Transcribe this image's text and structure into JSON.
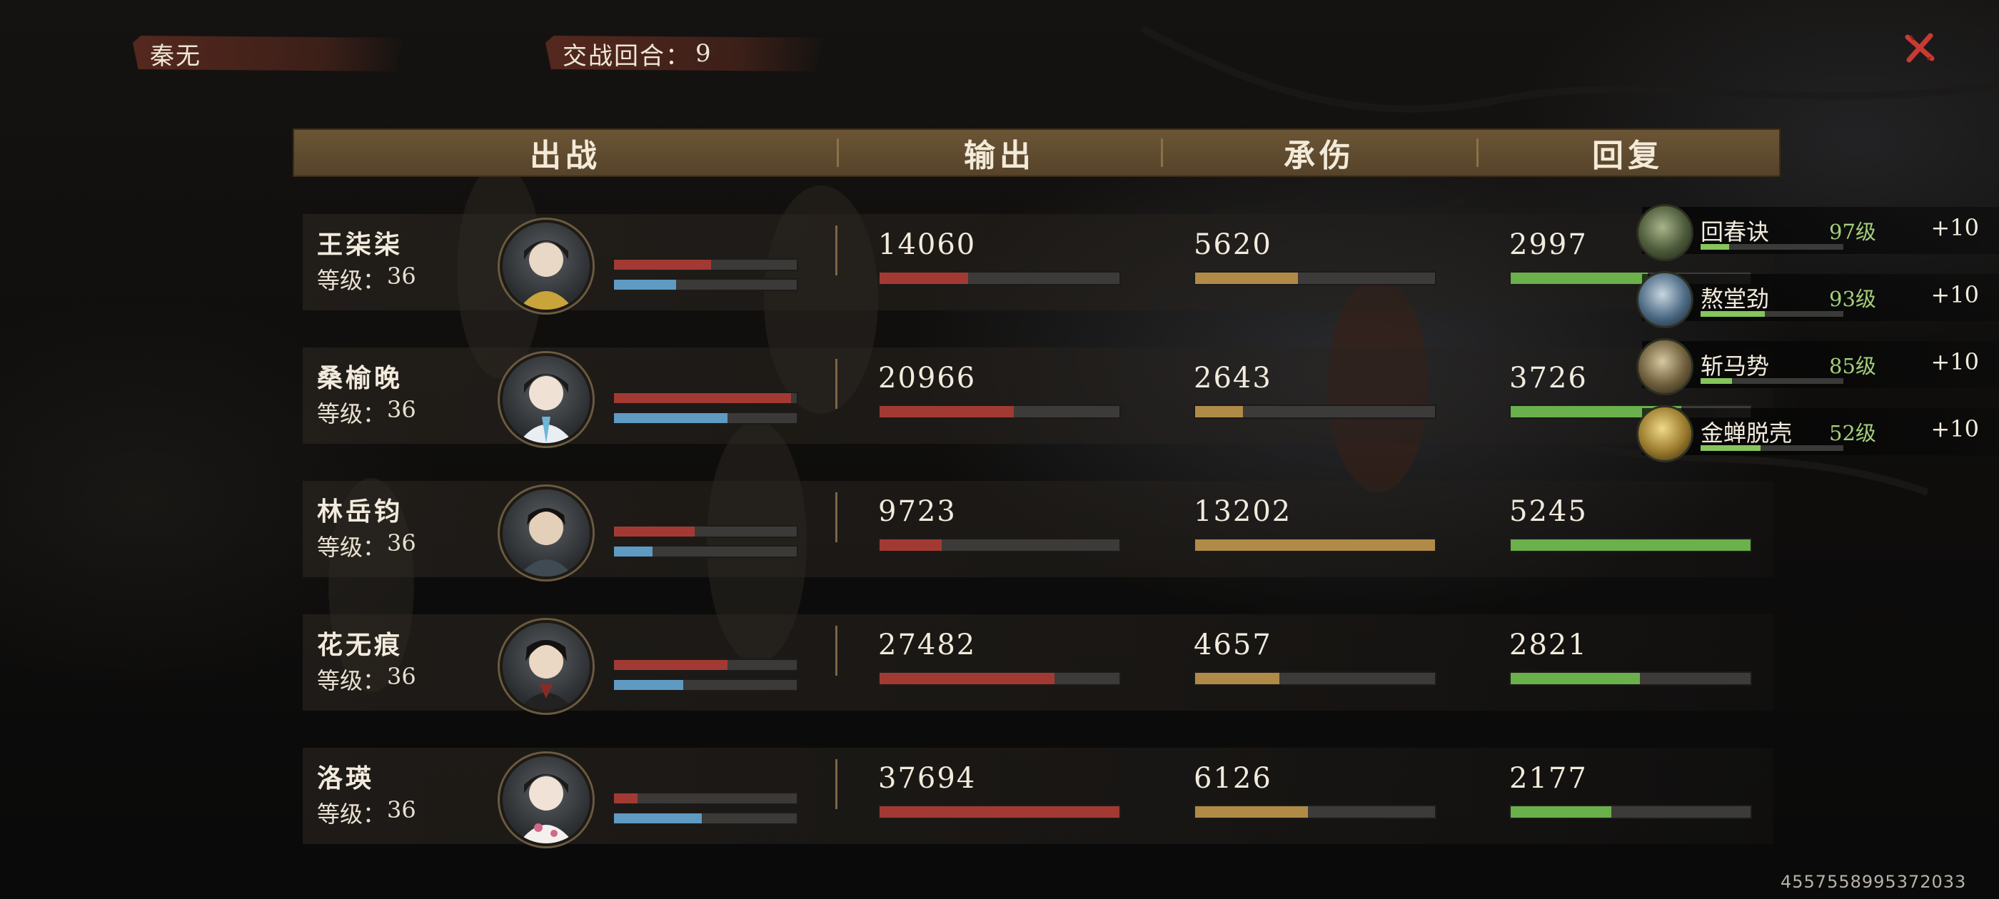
{
  "topbar": {
    "player_name": "秦无",
    "rounds_label": "交战回合：",
    "rounds_value": "9"
  },
  "header": {
    "col_heroes": "出战",
    "col_damage": "输出",
    "col_taken": "承伤",
    "col_heal": "回复"
  },
  "level_prefix": "等级：",
  "colors": {
    "damage": "#a23a33",
    "taken": "#b08a47",
    "heal": "#6ab04b",
    "mana": "#5f9ac2"
  },
  "heroes": [
    {
      "name": "王柒柒",
      "level": "36",
      "hp_fraction": 0.53,
      "mp_fraction": 0.34,
      "damage": "14060",
      "damage_fraction": 0.37,
      "taken": "5620",
      "taken_fraction": 0.43,
      "heal": "2997",
      "heal_fraction": 0.57
    },
    {
      "name": "桑榆晚",
      "level": "36",
      "hp_fraction": 0.97,
      "mp_fraction": 0.62,
      "damage": "20966",
      "damage_fraction": 0.56,
      "taken": "2643",
      "taken_fraction": 0.2,
      "heal": "3726",
      "heal_fraction": 0.71
    },
    {
      "name": "林岳钧",
      "level": "36",
      "hp_fraction": 0.44,
      "mp_fraction": 0.21,
      "damage": "9723",
      "damage_fraction": 0.26,
      "taken": "13202",
      "taken_fraction": 1.0,
      "heal": "5245",
      "heal_fraction": 1.0
    },
    {
      "name": "花无痕",
      "level": "36",
      "hp_fraction": 0.62,
      "mp_fraction": 0.38,
      "damage": "27482",
      "damage_fraction": 0.73,
      "taken": "4657",
      "taken_fraction": 0.35,
      "heal": "2821",
      "heal_fraction": 0.54
    },
    {
      "name": "洛瑛",
      "level": "36",
      "hp_fraction": 0.13,
      "mp_fraction": 0.48,
      "damage": "37694",
      "damage_fraction": 1.0,
      "taken": "6126",
      "taken_fraction": 0.47,
      "heal": "2177",
      "heal_fraction": 0.42
    }
  ],
  "skills": [
    {
      "name": "回春诀",
      "level": "97级",
      "gain": "+10",
      "xp_fraction": 0.2
    },
    {
      "name": "熬堂劲",
      "level": "93级",
      "gain": "+10",
      "xp_fraction": 0.45
    },
    {
      "name": "斩马势",
      "level": "85级",
      "gain": "+10",
      "xp_fraction": 0.22
    },
    {
      "name": "金蝉脱壳",
      "level": "52级",
      "gain": "+10",
      "xp_fraction": 0.42
    }
  ],
  "footer_id": "4557558995372033"
}
